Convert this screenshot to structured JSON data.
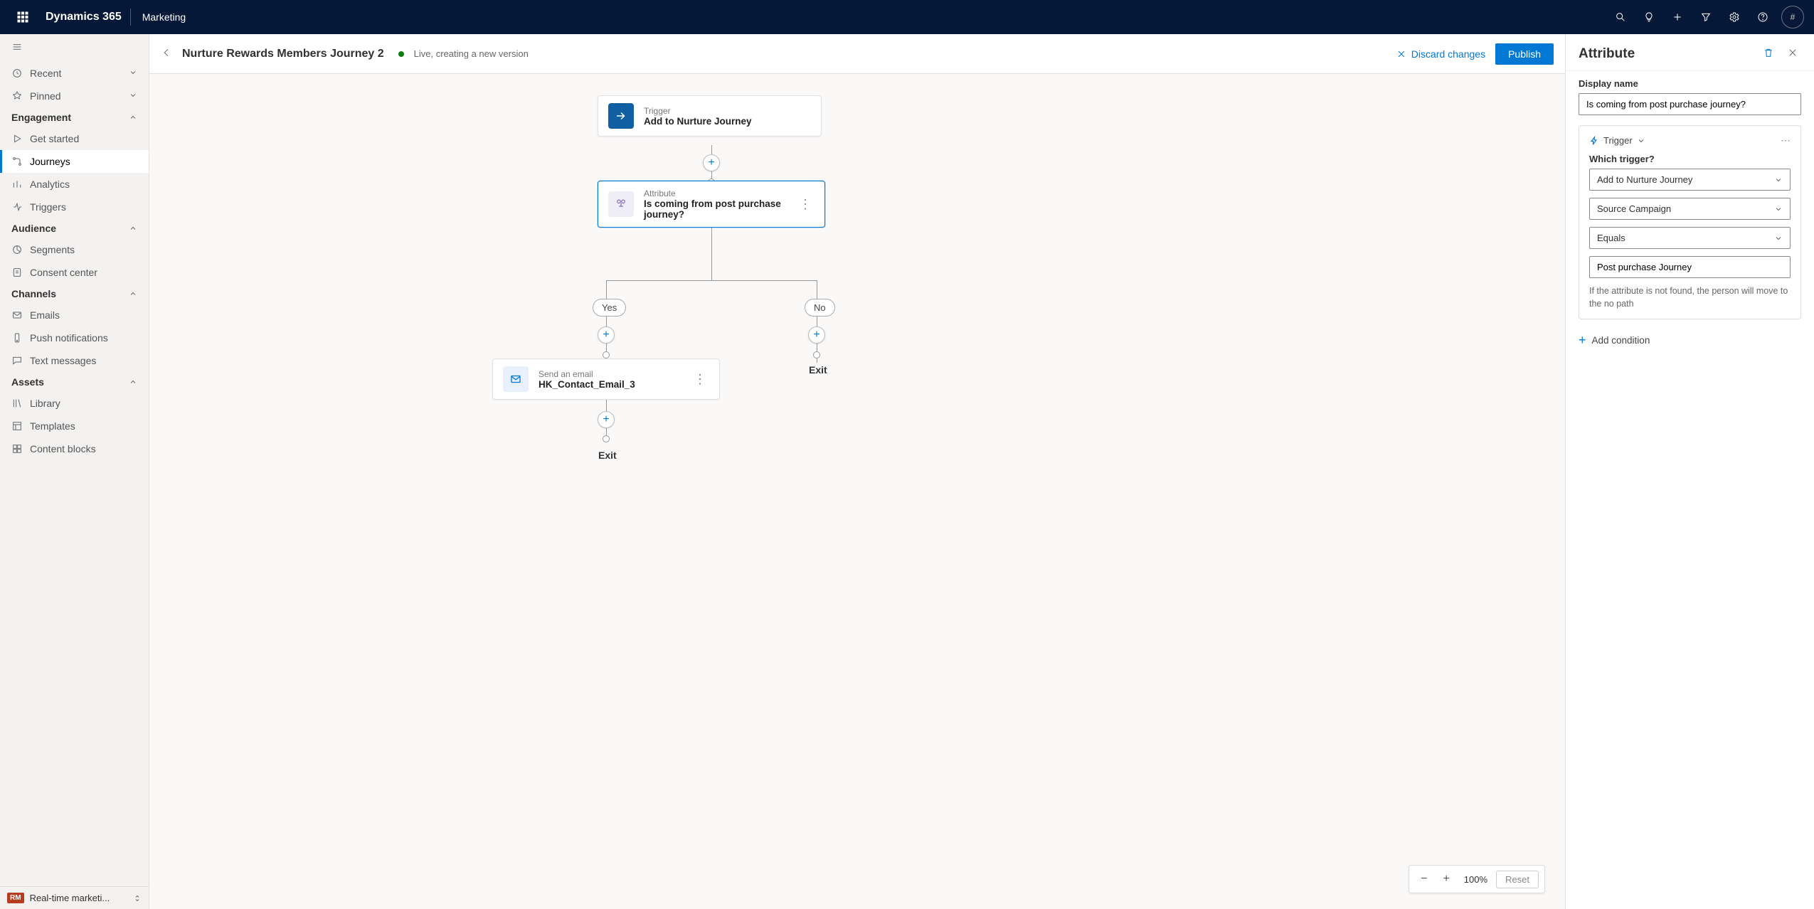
{
  "navbar": {
    "brand": "Dynamics 365",
    "area": "Marketing",
    "avatar_text": "#"
  },
  "sidebar": {
    "recent": "Recent",
    "pinned": "Pinned",
    "sections": {
      "engagement": "Engagement",
      "audience": "Audience",
      "channels": "Channels",
      "assets": "Assets"
    },
    "items": {
      "get_started": "Get started",
      "journeys": "Journeys",
      "analytics": "Analytics",
      "triggers": "Triggers",
      "segments": "Segments",
      "consent_center": "Consent center",
      "emails": "Emails",
      "push": "Push notifications",
      "texts": "Text messages",
      "library": "Library",
      "templates": "Templates",
      "content_blocks": "Content blocks"
    },
    "area_switch": {
      "badge": "RM",
      "label": "Real-time marketi..."
    }
  },
  "cmdbar": {
    "title": "Nurture Rewards Members Journey 2",
    "status": "Live, creating a new version",
    "discard": "Discard changes",
    "publish": "Publish"
  },
  "canvas": {
    "zoom": "100%",
    "reset": "Reset",
    "nodes": {
      "trigger": {
        "type": "Trigger",
        "name": "Add to Nurture Journey"
      },
      "attribute": {
        "type": "Attribute",
        "name": "Is coming from post purchase journey?"
      },
      "email": {
        "type": "Send an email",
        "name": "HK_Contact_Email_3"
      }
    },
    "branches": {
      "yes": "Yes",
      "no": "No"
    },
    "exit": "Exit"
  },
  "panel": {
    "title": "Attribute",
    "display_name_label": "Display name",
    "display_name_value": "Is coming from post purchase journey?",
    "trigger_tag": "Trigger",
    "which_trigger_label": "Which trigger?",
    "trigger_select": "Add to Nurture Journey",
    "field_select": "Source Campaign",
    "operator_select": "Equals",
    "value_input": "Post purchase Journey",
    "helper": "If the attribute is not found, the person will move to the no path",
    "add_condition": "Add condition"
  }
}
